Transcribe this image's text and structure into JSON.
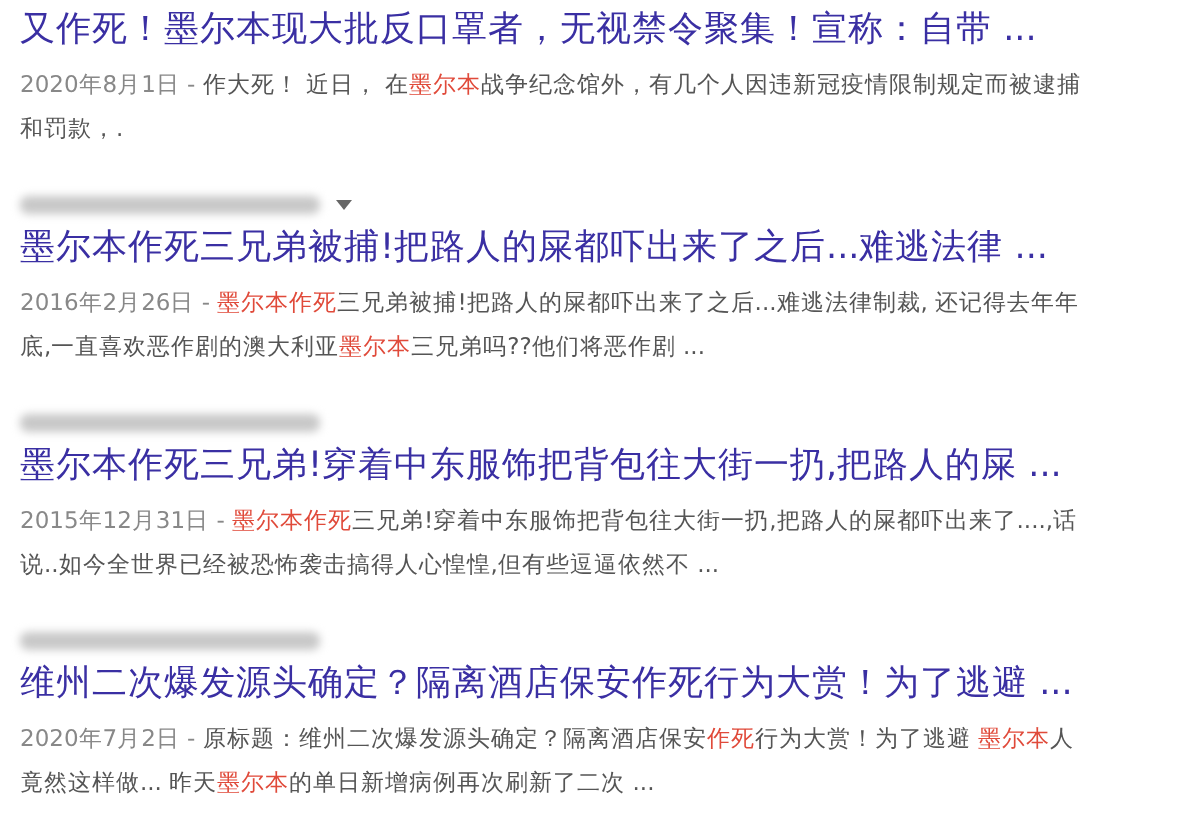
{
  "results": [
    {
      "url_caret": false,
      "title": "又作死！墨尔本现大批反口罩者，无视禁令聚集！宣称：自带 ...",
      "date": "2020年8月1日 - ",
      "snippet": [
        {
          "text": "作大死！ 近日， 在",
          "highlight": false
        },
        {
          "text": "墨尔本",
          "highlight": true
        },
        {
          "text": "战争纪念馆外，有几个人因违新冠疫情限制规定而被逮捕和罚款，.",
          "highlight": false
        }
      ]
    },
    {
      "url_caret": true,
      "title": "墨尔本作死三兄弟被捕!把路人的屎都吓出来了之后...难逃法律 ...",
      "date": "2016年2月26日 - ",
      "snippet": [
        {
          "text": "墨尔本作死",
          "highlight": true
        },
        {
          "text": "三兄弟被捕!把路人的屎都吓出来了之后...难逃法律制裁, 还记得去年年底,一直喜欢恶作剧的澳大利亚",
          "highlight": false
        },
        {
          "text": "墨尔本",
          "highlight": true
        },
        {
          "text": "三兄弟吗??他们将恶作剧 ...",
          "highlight": false
        }
      ]
    },
    {
      "url_caret": false,
      "title": "墨尔本作死三兄弟!穿着中东服饰把背包往大街一扔,把路人的屎 ...",
      "date": "2015年12月31日 - ",
      "snippet": [
        {
          "text": "墨尔本作死",
          "highlight": true
        },
        {
          "text": "三兄弟!穿着中东服饰把背包往大街一扔,把路人的屎都吓出来了....,话说..如今全世界已经被恐怖袭击搞得人心惶惶,但有些逗逼依然不 ...",
          "highlight": false
        }
      ]
    },
    {
      "url_caret": false,
      "title": "维州二次爆发源头确定？隔离酒店保安作死行为大赏！为了逃避 ...",
      "date": "2020年7月2日 - ",
      "snippet": [
        {
          "text": "原标题：维州二次爆发源头确定？隔离酒店保安",
          "highlight": false
        },
        {
          "text": "作死",
          "highlight": true
        },
        {
          "text": "行为大赏！为了逃避 ",
          "highlight": false
        },
        {
          "text": "墨尔本",
          "highlight": true
        },
        {
          "text": "人竟然这样做... 昨天",
          "highlight": false
        },
        {
          "text": "墨尔本",
          "highlight": true
        },
        {
          "text": "的单日新增病例再次刷新了二次 ...",
          "highlight": false
        }
      ]
    }
  ]
}
